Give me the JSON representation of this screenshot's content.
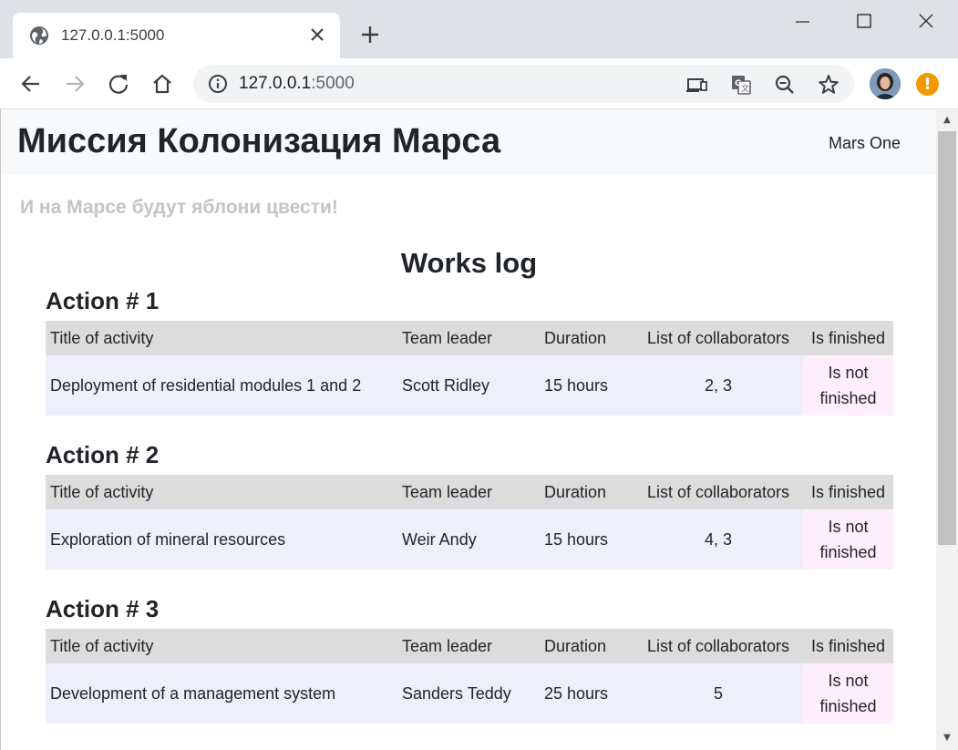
{
  "browser": {
    "tab_title": "127.0.0.1:5000",
    "url_host": "127.0.0.1",
    "url_port": ":5000",
    "icons": [
      "globe-icon",
      "close-icon",
      "plus-icon",
      "minimize-icon",
      "maximize-icon",
      "window-close-icon",
      "back-arrow-icon",
      "forward-arrow-icon",
      "reload-icon",
      "home-icon",
      "info-icon",
      "cast-icon",
      "translate-icon",
      "zoom-out-icon",
      "star-icon",
      "profile-avatar",
      "alert-icon"
    ],
    "alert_symbol": "!",
    "accent_color": "#f29900"
  },
  "site": {
    "title": "Миссия Колонизация Марса",
    "brand": "Mars One",
    "slogan": "И на Марсе будут яблони цвести!",
    "page_heading": "Works log"
  },
  "table_headers": [
    "Title of activity",
    "Team leader",
    "Duration",
    "List of collaborators",
    "Is finished"
  ],
  "actions": [
    {
      "heading": "Action # 1",
      "title": "Deployment of residential modules 1 and 2",
      "leader": "Scott Ridley",
      "duration": "15 hours",
      "collaborators": "2, 3",
      "finished": "Is not finished"
    },
    {
      "heading": "Action # 2",
      "title": "Exploration of mineral resources",
      "leader": "Weir Andy",
      "duration": "15 hours",
      "collaborators": "4, 3",
      "finished": "Is not finished"
    },
    {
      "heading": "Action # 3",
      "title": "Development of a management system",
      "leader": "Sanders Teddy",
      "duration": "25 hours",
      "collaborators": "5",
      "finished": "Is not finished"
    }
  ],
  "scrollbar": {
    "up_arrow": "▲",
    "down_arrow": "▼"
  }
}
